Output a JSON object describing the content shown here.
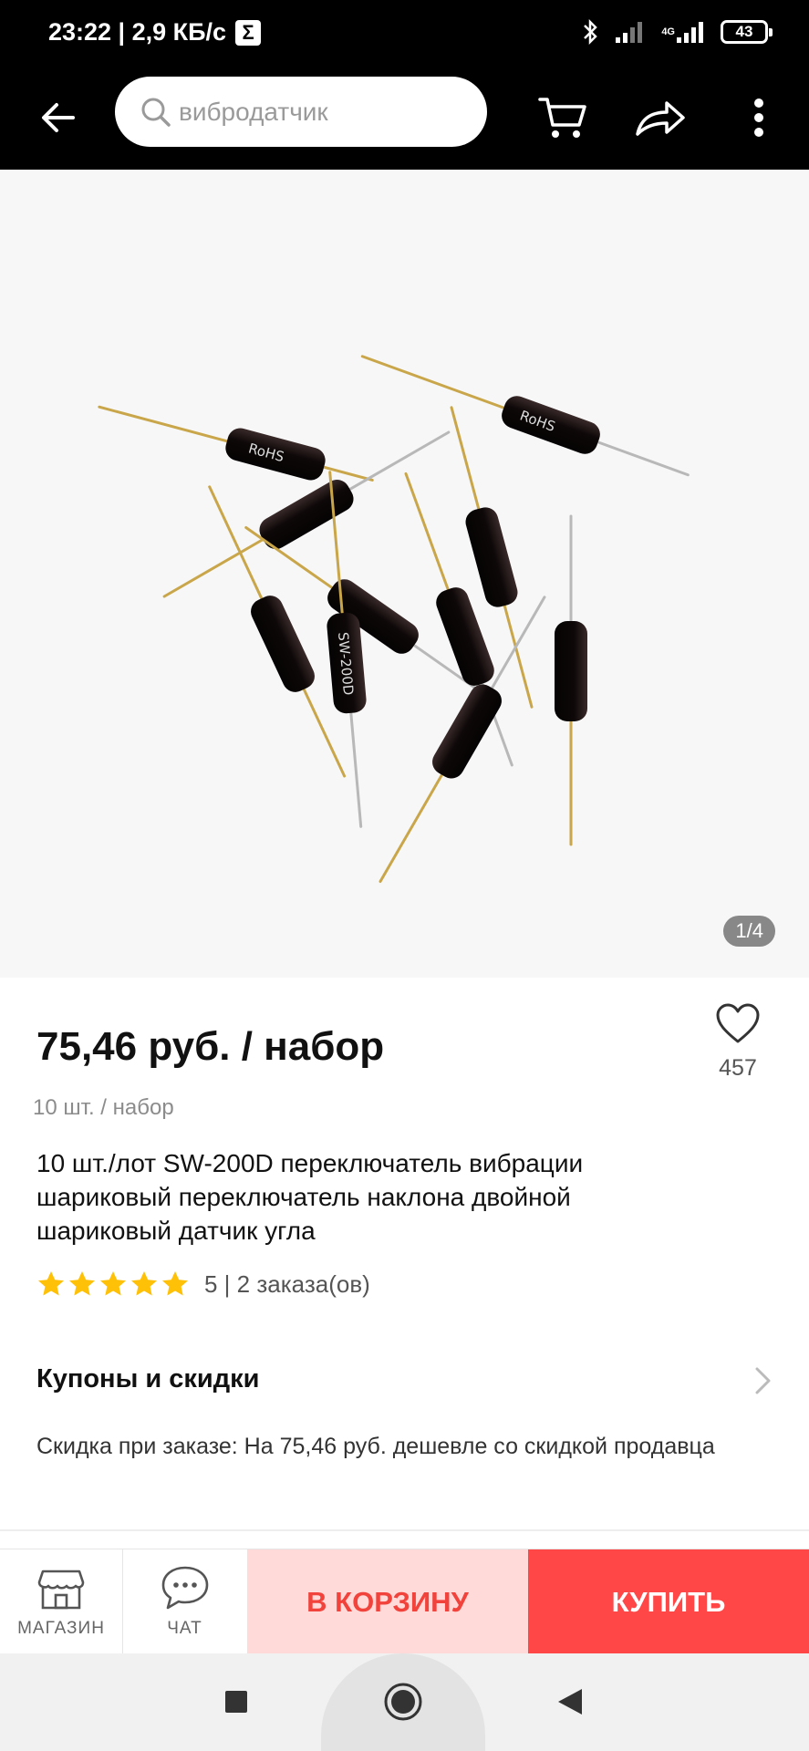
{
  "status_bar": {
    "time_speed": "23:22 | 2,9 КБ/с",
    "sigma_icon": "Σ",
    "network_label": "4G",
    "battery": "43"
  },
  "app_bar": {
    "search_placeholder": "вибродатчик",
    "icons": [
      "back-arrow-icon",
      "search-icon",
      "cart-icon",
      "share-icon",
      "more-vert-icon"
    ]
  },
  "gallery": {
    "counter": "1/4",
    "sensor_print_1": "RoHS",
    "sensor_print_2": "SW-200D"
  },
  "product": {
    "price": "75,46 руб. / набор",
    "unit": "10 шт. / набор",
    "favorites_count": "457",
    "title": "10 шт./лот SW-200D переключатель вибрации шариковый переключатель наклона двойной шариковый датчик угла",
    "rating": 5,
    "rating_text": "5 | 2 заказа(ов)"
  },
  "coupons": {
    "label": "Купоны и скидки",
    "discount_text": "Скидка при заказе: На 75,46 руб. дешевле со скидкой продавца"
  },
  "action_bar": {
    "store_label": "МАГАЗИН",
    "chat_label": "ЧАТ",
    "cart_label": "В КОРЗИНУ",
    "buy_label": "КУПИТЬ"
  },
  "colors": {
    "accent": "#ff4747",
    "cart_bg": "#ffdad8",
    "cart_text": "#f2423c",
    "star": "#ffc107"
  }
}
